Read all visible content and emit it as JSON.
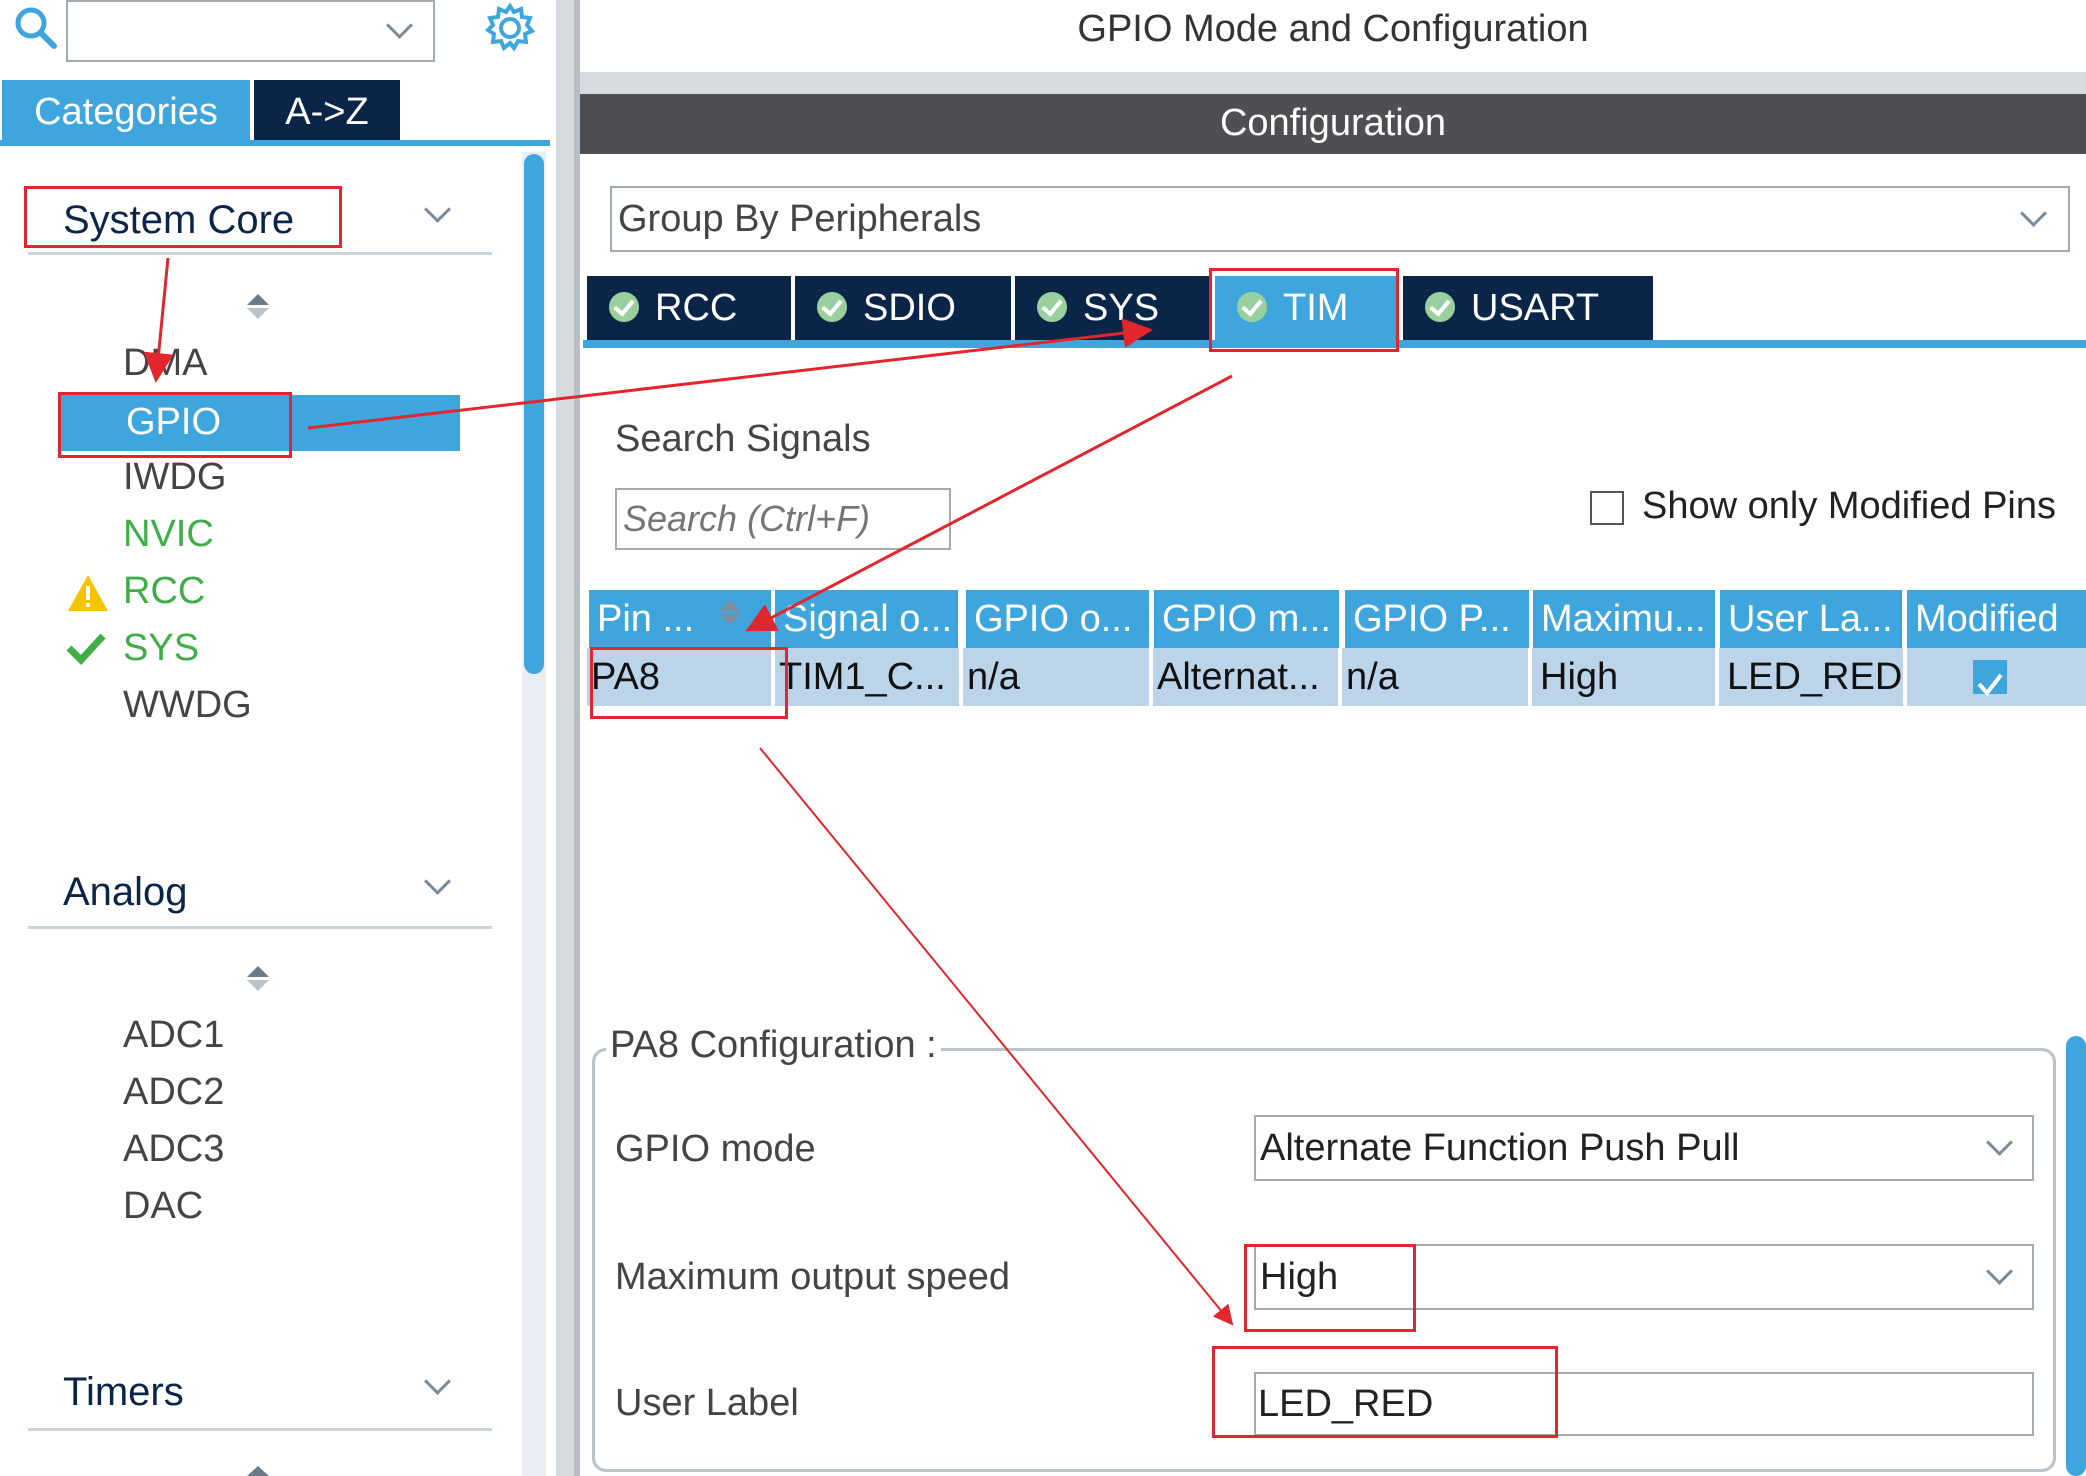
{
  "left": {
    "search_value": "",
    "tabs": {
      "categories": "Categories",
      "az": "A->Z"
    },
    "sections": {
      "system_core": {
        "title": "System Core",
        "items": [
          "DMA",
          "GPIO",
          "IWDG",
          "NVIC",
          "RCC",
          "SYS",
          "WWDG"
        ],
        "selected": "GPIO"
      },
      "analog": {
        "title": "Analog",
        "items": [
          "ADC1",
          "ADC2",
          "ADC3",
          "DAC"
        ]
      },
      "timers": {
        "title": "Timers"
      }
    }
  },
  "right": {
    "title": "GPIO Mode and Configuration",
    "config_header": "Configuration",
    "group_by": "Group By Peripherals",
    "tabs": [
      "RCC",
      "SDIO",
      "SYS",
      "TIM",
      "USART"
    ],
    "active_tab": "TIM",
    "search_label": "Search Signals",
    "search_placeholder": "Search (Ctrl+F)",
    "show_modified_label": "Show only Modified Pins",
    "table": {
      "headers": [
        "Pin ...",
        "Signal o...",
        "GPIO o...",
        "GPIO m...",
        "GPIO P...",
        "Maximu...",
        "User La...",
        "Modified"
      ],
      "rows": [
        [
          "PA8",
          "TIM1_C...",
          "n/a",
          "Alternat...",
          "n/a",
          "High",
          "LED_RED",
          "checked"
        ]
      ]
    },
    "pin_config": {
      "legend": "PA8 Configuration :",
      "gpio_mode_label": "GPIO mode",
      "gpio_mode_value": "Alternate Function Push Pull",
      "speed_label": "Maximum output speed",
      "speed_value": "High",
      "user_label_label": "User Label",
      "user_label_value": "LED_RED"
    }
  },
  "colors": {
    "navy": "#0b2548",
    "accent_blue": "#3ea6dd",
    "annotation_red": "#e1262d",
    "status_green": "#3fae49",
    "warning_yellow": "#f5c400"
  }
}
